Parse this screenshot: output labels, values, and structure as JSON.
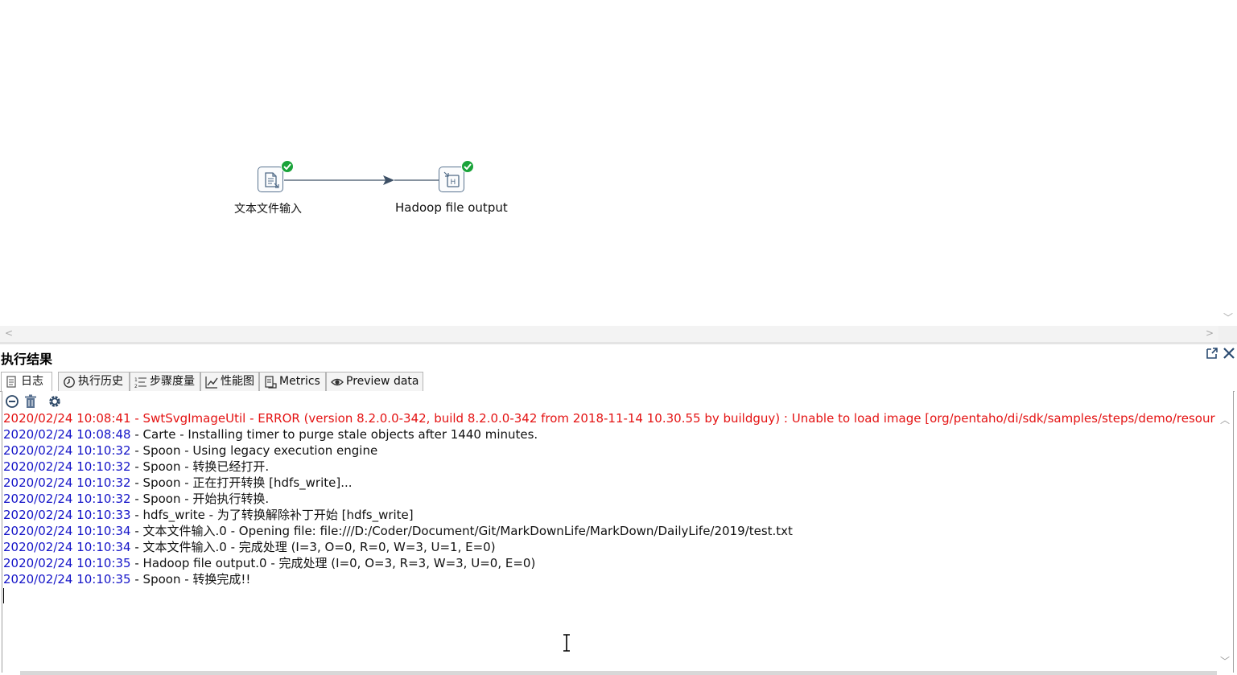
{
  "canvas": {
    "steps": [
      {
        "label": "文本文件输入",
        "icon": "text-file-input-icon",
        "status": "success"
      },
      {
        "label": "Hadoop file output",
        "icon": "hadoop-file-output-icon",
        "status": "success"
      }
    ],
    "hop": {
      "from": "文本文件输入",
      "to": "Hadoop file output"
    }
  },
  "panel": {
    "title": "执行结果",
    "tabs": [
      {
        "label": "日志",
        "icon": "log-icon",
        "active": true
      },
      {
        "label": "执行历史",
        "icon": "history-icon"
      },
      {
        "label": "步骤度量",
        "icon": "step-metrics-icon"
      },
      {
        "label": "性能图",
        "icon": "performance-chart-icon"
      },
      {
        "label": "Metrics",
        "icon": "metrics-icon"
      },
      {
        "label": "Preview data",
        "icon": "eye-icon"
      }
    ],
    "toolbar_icons": [
      "stop-icon",
      "trash-icon",
      "gear-icon"
    ],
    "header_icons": [
      "pop-out-icon",
      "close-icon"
    ]
  },
  "log": [
    {
      "timestamp": "2020/02/24 10:08:41",
      "message": " - SwtSvgImageUtil - ERROR (version 8.2.0.0-342, build 8.2.0.0-342 from 2018-11-14 10.30.55 by buildguy) : Unable to load image [org/pentaho/di/sdk/samples/steps/demo/resources/demo.svg]",
      "level": "error"
    },
    {
      "timestamp": "2020/02/24 10:08:48",
      "message": " - Carte - Installing timer to purge stale objects after 1440 minutes."
    },
    {
      "timestamp": "2020/02/24 10:10:32",
      "message": " - Spoon - Using legacy execution engine"
    },
    {
      "timestamp": "2020/02/24 10:10:32",
      "message": " - Spoon - 转换已经打开."
    },
    {
      "timestamp": "2020/02/24 10:10:32",
      "message": " - Spoon - 正在打开转换 [hdfs_write]..."
    },
    {
      "timestamp": "2020/02/24 10:10:32",
      "message": " - Spoon - 开始执行转换."
    },
    {
      "timestamp": "2020/02/24 10:10:33",
      "message": " - hdfs_write - 为了转换解除补丁开始  [hdfs_write]"
    },
    {
      "timestamp": "2020/02/24 10:10:34",
      "message": " - 文本文件输入.0 - Opening file: file:///D:/Coder/Document/Git/MarkDownLife/MarkDown/DailyLife/2019/test.txt"
    },
    {
      "timestamp": "2020/02/24 10:10:34",
      "message": " - 文本文件输入.0 - 完成处理 (I=3, O=0, R=0, W=3, U=1, E=0)"
    },
    {
      "timestamp": "2020/02/24 10:10:35",
      "message": " - Hadoop file output.0 - 完成处理 (I=0, O=3, R=3, W=3, U=0, E=0)"
    },
    {
      "timestamp": "2020/02/24 10:10:35",
      "message": " - Spoon - 转换完成!!"
    }
  ],
  "colors": {
    "timestamp": "#1414c8",
    "error": "#e41212",
    "success": "#1aa33a",
    "hop": "#3d5066"
  }
}
